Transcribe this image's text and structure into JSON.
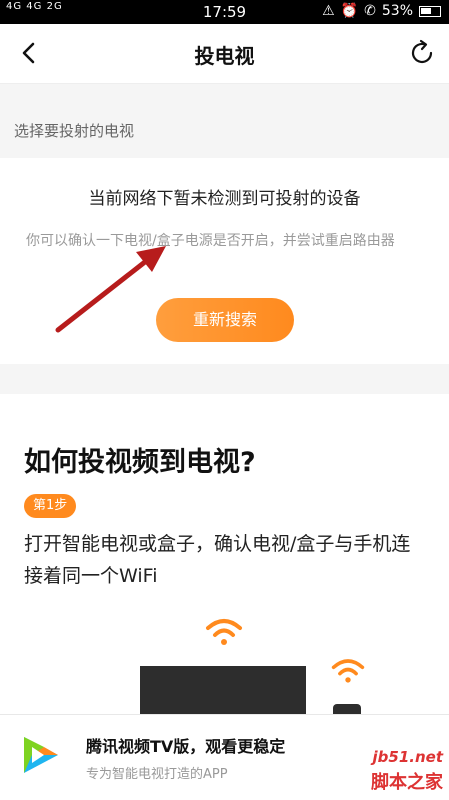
{
  "status_bar": {
    "signal": "4G 4G 2G",
    "time": "17:59",
    "battery": "53%"
  },
  "nav": {
    "title": "投电视"
  },
  "section_label": "选择要投射的电视",
  "empty_state": {
    "headline": "当前网络下暂未检测到可投射的设备",
    "description": "你可以确认一下电视/盒子电源是否开启，并尝试重启路由器",
    "button": "重新搜索"
  },
  "guide": {
    "heading": "如何投视频到电视?",
    "step_badge": "第1步",
    "step_text": "打开智能电视或盒子，确认电视/盒子与手机连接着同一个WiFi"
  },
  "banner": {
    "title": "腾讯视频TV版，观看更稳定",
    "subtitle": "专为智能电视打造的APP"
  },
  "watermark": {
    "domain": "jb51.net",
    "name": "脚本之家"
  },
  "colors": {
    "accent": "#ff8a1e",
    "arrow": "#b71c1c"
  }
}
